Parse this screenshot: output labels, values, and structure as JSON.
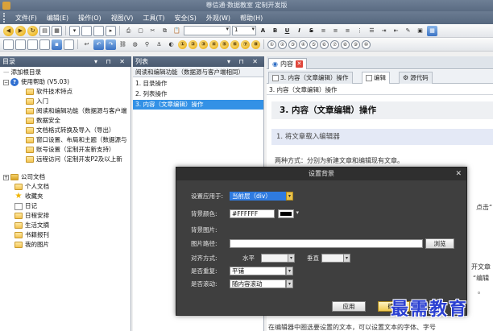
{
  "window": {
    "title": "尊信通·数据教室 定制开发版"
  },
  "menu": [
    "文件(F)",
    "编辑(E)",
    "操作(O)",
    "视图(V)",
    "工具(T)",
    "安全(S)",
    "外观(W)",
    "帮助(H)"
  ],
  "toolbar": {
    "font_size": "1",
    "bold": "B",
    "underline": "U",
    "italic": "I",
    "strike": "S",
    "numbers_row1": [
      "①",
      "②",
      "③",
      "④",
      "⑤",
      "⑥",
      "⑦",
      "⑧"
    ],
    "numbers_row2": [
      "①",
      "②",
      "③",
      "④",
      "⑤",
      "⑥",
      "⑦",
      "⑧",
      "⑨",
      "⑩"
    ]
  },
  "left_pane": {
    "title": "目录",
    "controls": "▾ ⊓ ✕",
    "items": [
      {
        "label": "添加根目录",
        "level": 0,
        "icon": "none"
      },
      {
        "label": "使用帮助 (V5.03)",
        "level": 1,
        "icon": "help"
      },
      {
        "label": "软件技术特点",
        "level": 2,
        "icon": "folder"
      },
      {
        "label": "入门",
        "level": 2,
        "icon": "folder"
      },
      {
        "label": "阅读和编辑功能（数据源与客户端",
        "level": 2,
        "icon": "folder"
      },
      {
        "label": "数据安全",
        "level": 2,
        "icon": "folder"
      },
      {
        "label": "文档格式转换及导入（导出）",
        "level": 2,
        "icon": "folder"
      },
      {
        "label": "窗口设置、布局和主题（数据源与",
        "level": 2,
        "icon": "folder"
      },
      {
        "label": "账号设置（定制开发新支持）",
        "level": 2,
        "icon": "folder"
      },
      {
        "label": "远程访问（定制开发P2及以上新",
        "level": 2,
        "icon": "folder"
      },
      {
        "label": "公司文档",
        "level": 1,
        "icon": "folder-dark"
      },
      {
        "label": "个人文档",
        "level": 1,
        "icon": "folder"
      },
      {
        "label": "收藏夹",
        "level": 1,
        "icon": "star"
      },
      {
        "label": "日记",
        "level": 1,
        "icon": "page"
      },
      {
        "label": "日程安排",
        "level": 1,
        "icon": "folder"
      },
      {
        "label": "生活文摘",
        "level": 1,
        "icon": "folder"
      },
      {
        "label": "书籍报刊",
        "level": 1,
        "icon": "folder"
      },
      {
        "label": "我的图片",
        "level": 1,
        "icon": "folder"
      }
    ]
  },
  "list_pane": {
    "title": "列表",
    "controls": "▾ ⊓ ✕",
    "header": "阅读和编辑功能（数据源与客户端相同）",
    "items": [
      "1. 目录操作",
      "2. 列表操作",
      "3. 内容（文章编辑）操作"
    ],
    "selected_index": 2
  },
  "content": {
    "tab_label": "内容",
    "subtabs": [
      "3. 内容（文章编辑）操作",
      "编辑",
      "源代码"
    ],
    "active_subtab": 1,
    "path": "3. 内容（文章编辑）操作",
    "heading": "3.  内容（文章编辑）操作",
    "subheading": "1.  将文章载入编辑器",
    "paragraph1": "两种方式：分别为新建文章和编辑现有文章。",
    "fragments": [
      "点击“",
      "开文章",
      "“编辑",
      "。"
    ],
    "bottom_text": "在编辑器中圈选要设置的文本，可以设置文本的字体、字号"
  },
  "dialog": {
    "title": "设置背景",
    "close": "✕",
    "apply_to_label": "设置应用于:",
    "apply_to_value": "当前层（div）",
    "bg_color_label": "背景颜色:",
    "bg_color_value": "#FFFFFF",
    "bg_image_label": "背景图片:",
    "image_path_label": "图片路径:",
    "image_path_value": "",
    "browse_button": "浏览",
    "align_label": "对齐方式:",
    "horizontal_label": "水平",
    "vertical_label": "垂直",
    "repeat_label": "是否重复:",
    "repeat_value": "平铺",
    "scroll_label": "是否滚动:",
    "scroll_value": "随内容滚动",
    "apply_button": "应用",
    "ok_button": "确定"
  },
  "watermark": "最需教育",
  "colors": {
    "selection": "#3391e6",
    "dialog_bg": "#3f3f3f",
    "titlebar": "#5a6b82"
  }
}
